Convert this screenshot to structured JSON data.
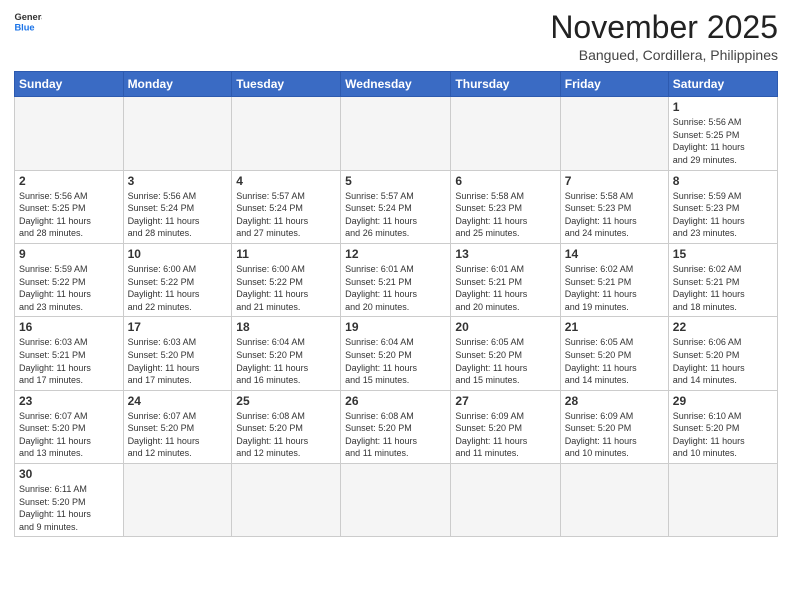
{
  "header": {
    "logo_general": "General",
    "logo_blue": "Blue",
    "month_title": "November 2025",
    "location": "Bangued, Cordillera, Philippines"
  },
  "weekdays": [
    "Sunday",
    "Monday",
    "Tuesday",
    "Wednesday",
    "Thursday",
    "Friday",
    "Saturday"
  ],
  "weeks": [
    [
      {
        "day": "",
        "text": ""
      },
      {
        "day": "",
        "text": ""
      },
      {
        "day": "",
        "text": ""
      },
      {
        "day": "",
        "text": ""
      },
      {
        "day": "",
        "text": ""
      },
      {
        "day": "",
        "text": ""
      },
      {
        "day": "1",
        "text": "Sunrise: 5:56 AM\nSunset: 5:25 PM\nDaylight: 11 hours\nand 29 minutes."
      }
    ],
    [
      {
        "day": "2",
        "text": "Sunrise: 5:56 AM\nSunset: 5:25 PM\nDaylight: 11 hours\nand 28 minutes."
      },
      {
        "day": "3",
        "text": "Sunrise: 5:56 AM\nSunset: 5:24 PM\nDaylight: 11 hours\nand 28 minutes."
      },
      {
        "day": "4",
        "text": "Sunrise: 5:57 AM\nSunset: 5:24 PM\nDaylight: 11 hours\nand 27 minutes."
      },
      {
        "day": "5",
        "text": "Sunrise: 5:57 AM\nSunset: 5:24 PM\nDaylight: 11 hours\nand 26 minutes."
      },
      {
        "day": "6",
        "text": "Sunrise: 5:58 AM\nSunset: 5:23 PM\nDaylight: 11 hours\nand 25 minutes."
      },
      {
        "day": "7",
        "text": "Sunrise: 5:58 AM\nSunset: 5:23 PM\nDaylight: 11 hours\nand 24 minutes."
      },
      {
        "day": "8",
        "text": "Sunrise: 5:59 AM\nSunset: 5:23 PM\nDaylight: 11 hours\nand 23 minutes."
      }
    ],
    [
      {
        "day": "9",
        "text": "Sunrise: 5:59 AM\nSunset: 5:22 PM\nDaylight: 11 hours\nand 23 minutes."
      },
      {
        "day": "10",
        "text": "Sunrise: 6:00 AM\nSunset: 5:22 PM\nDaylight: 11 hours\nand 22 minutes."
      },
      {
        "day": "11",
        "text": "Sunrise: 6:00 AM\nSunset: 5:22 PM\nDaylight: 11 hours\nand 21 minutes."
      },
      {
        "day": "12",
        "text": "Sunrise: 6:01 AM\nSunset: 5:21 PM\nDaylight: 11 hours\nand 20 minutes."
      },
      {
        "day": "13",
        "text": "Sunrise: 6:01 AM\nSunset: 5:21 PM\nDaylight: 11 hours\nand 20 minutes."
      },
      {
        "day": "14",
        "text": "Sunrise: 6:02 AM\nSunset: 5:21 PM\nDaylight: 11 hours\nand 19 minutes."
      },
      {
        "day": "15",
        "text": "Sunrise: 6:02 AM\nSunset: 5:21 PM\nDaylight: 11 hours\nand 18 minutes."
      }
    ],
    [
      {
        "day": "16",
        "text": "Sunrise: 6:03 AM\nSunset: 5:21 PM\nDaylight: 11 hours\nand 17 minutes."
      },
      {
        "day": "17",
        "text": "Sunrise: 6:03 AM\nSunset: 5:20 PM\nDaylight: 11 hours\nand 17 minutes."
      },
      {
        "day": "18",
        "text": "Sunrise: 6:04 AM\nSunset: 5:20 PM\nDaylight: 11 hours\nand 16 minutes."
      },
      {
        "day": "19",
        "text": "Sunrise: 6:04 AM\nSunset: 5:20 PM\nDaylight: 11 hours\nand 15 minutes."
      },
      {
        "day": "20",
        "text": "Sunrise: 6:05 AM\nSunset: 5:20 PM\nDaylight: 11 hours\nand 15 minutes."
      },
      {
        "day": "21",
        "text": "Sunrise: 6:05 AM\nSunset: 5:20 PM\nDaylight: 11 hours\nand 14 minutes."
      },
      {
        "day": "22",
        "text": "Sunrise: 6:06 AM\nSunset: 5:20 PM\nDaylight: 11 hours\nand 14 minutes."
      }
    ],
    [
      {
        "day": "23",
        "text": "Sunrise: 6:07 AM\nSunset: 5:20 PM\nDaylight: 11 hours\nand 13 minutes."
      },
      {
        "day": "24",
        "text": "Sunrise: 6:07 AM\nSunset: 5:20 PM\nDaylight: 11 hours\nand 12 minutes."
      },
      {
        "day": "25",
        "text": "Sunrise: 6:08 AM\nSunset: 5:20 PM\nDaylight: 11 hours\nand 12 minutes."
      },
      {
        "day": "26",
        "text": "Sunrise: 6:08 AM\nSunset: 5:20 PM\nDaylight: 11 hours\nand 11 minutes."
      },
      {
        "day": "27",
        "text": "Sunrise: 6:09 AM\nSunset: 5:20 PM\nDaylight: 11 hours\nand 11 minutes."
      },
      {
        "day": "28",
        "text": "Sunrise: 6:09 AM\nSunset: 5:20 PM\nDaylight: 11 hours\nand 10 minutes."
      },
      {
        "day": "29",
        "text": "Sunrise: 6:10 AM\nSunset: 5:20 PM\nDaylight: 11 hours\nand 10 minutes."
      }
    ],
    [
      {
        "day": "30",
        "text": "Sunrise: 6:11 AM\nSunset: 5:20 PM\nDaylight: 11 hours\nand 9 minutes."
      },
      {
        "day": "",
        "text": ""
      },
      {
        "day": "",
        "text": ""
      },
      {
        "day": "",
        "text": ""
      },
      {
        "day": "",
        "text": ""
      },
      {
        "day": "",
        "text": ""
      },
      {
        "day": "",
        "text": ""
      }
    ]
  ]
}
